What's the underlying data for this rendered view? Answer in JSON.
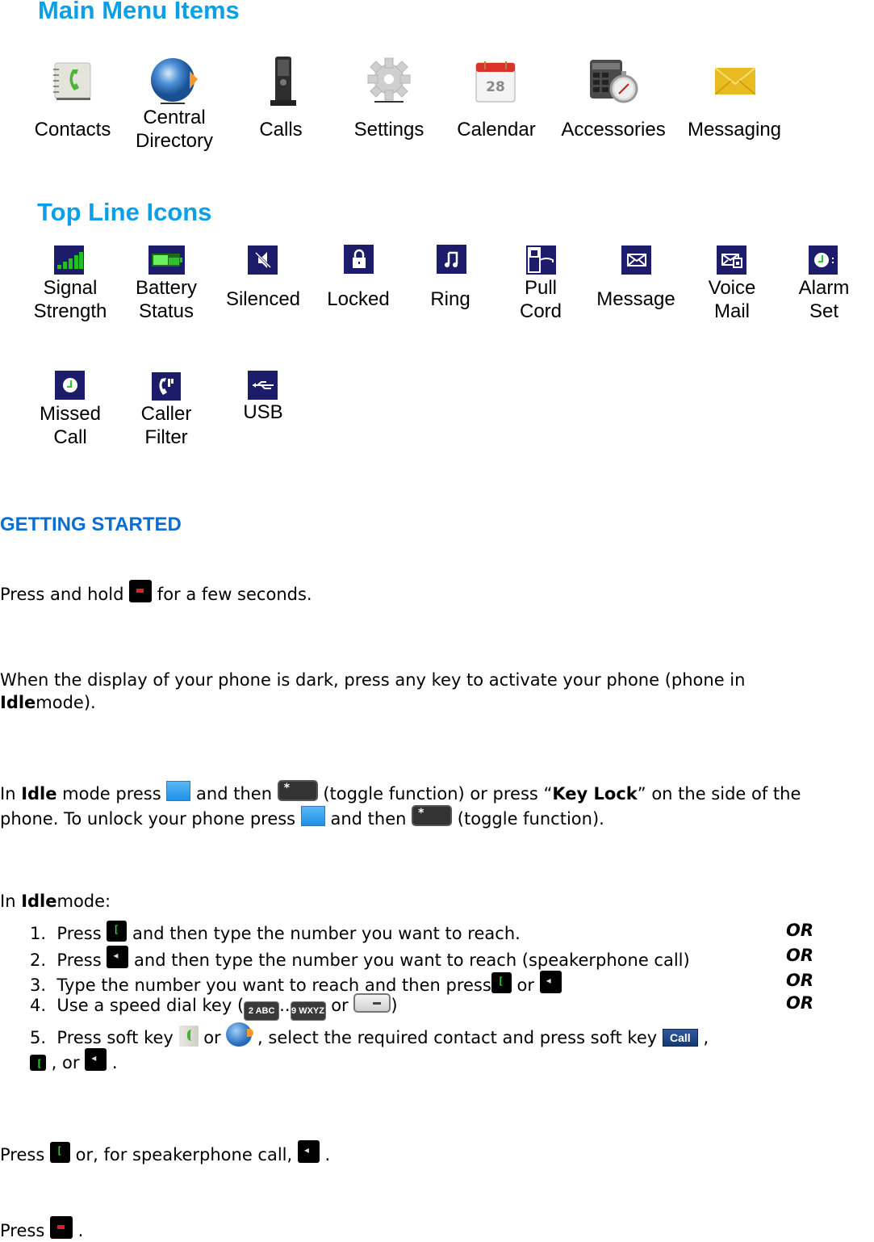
{
  "main_menu": {
    "title": "Main Menu Items",
    "items": [
      {
        "icon": "contacts-icon",
        "label_line1": "Contacts",
        "label_line2": ""
      },
      {
        "icon": "central-directory-globe-icon",
        "label_line1": "Central",
        "label_line2": "Directory"
      },
      {
        "icon": "calls-phone-icon",
        "label_line1": "Calls",
        "label_line2": ""
      },
      {
        "icon": "settings-gear-icon",
        "label_line1": "Settings",
        "label_line2": ""
      },
      {
        "icon": "calendar-icon",
        "label_line1": "Calendar",
        "label_line2": "",
        "calendar_day": "28"
      },
      {
        "icon": "accessories-calculator-icon",
        "label_line1": "Accessories",
        "label_line2": ""
      },
      {
        "icon": "messaging-envelope-icon",
        "label_line1": "Messaging",
        "label_line2": ""
      }
    ]
  },
  "top_line": {
    "title": "Top Line Icons",
    "items": [
      {
        "icon": "signal-strength-icon",
        "label_line1": "Signal",
        "label_line2": "Strength"
      },
      {
        "icon": "battery-status-icon",
        "label_line1": "Battery",
        "label_line2": "Status"
      },
      {
        "icon": "silenced-icon",
        "label_line1": "Silenced",
        "label_line2": ""
      },
      {
        "icon": "locked-icon",
        "label_line1": "Locked",
        "label_line2": ""
      },
      {
        "icon": "ring-icon",
        "label_line1": "Ring",
        "label_line2": ""
      },
      {
        "icon": "pull-cord-icon",
        "label_line1": "Pull",
        "label_line2": "Cord"
      },
      {
        "icon": "message-icon",
        "label_line1": "Message",
        "label_line2": ""
      },
      {
        "icon": "voice-mail-icon",
        "label_line1": "Voice",
        "label_line2": "Mail"
      },
      {
        "icon": "alarm-set-icon",
        "label_line1": "Alarm",
        "label_line2": "Set"
      },
      {
        "icon": "missed-call-icon",
        "label_line1": "Missed",
        "label_line2": "Call"
      },
      {
        "icon": "caller-filter-icon",
        "label_line1": "Caller",
        "label_line2": "Filter"
      },
      {
        "icon": "usb-icon",
        "label_line1": "USB",
        "label_line2": ""
      }
    ]
  },
  "getting_started": {
    "title": "GETTING STARTED",
    "p1": {
      "a": "Press and hold ",
      "b": " for a few seconds."
    },
    "p2": {
      "line1": "When the display of your phone is dark, press any key to activate your phone (phone in",
      "bold": "Idle",
      "rest": "mode)."
    },
    "p3": {
      "a": "In ",
      "bold1": "Idle",
      "b": " mode press ",
      "c": " and then ",
      "d": " (toggle function) or press “",
      "bold2": "Key Lock",
      "e": "” on the side of the",
      "line2a": "phone. To unlock your phone press ",
      "line2b": " and then ",
      "line2c": " (toggle function)."
    },
    "p4": {
      "a": "In ",
      "bold": "Idle",
      "b": "mode:"
    },
    "steps": [
      {
        "num": "1.",
        "a": "Press ",
        "b": " and then type the number you want to reach."
      },
      {
        "num": "2.",
        "a": "Press ",
        "b": " and then type the number you want to reach (speakerphone call)"
      },
      {
        "num": "3.",
        "a": "Type the number you want to reach and then press",
        "b": " or "
      },
      {
        "num": "4.",
        "a": "Use a speed dial key (",
        "b": "..",
        "c": " or ",
        "d": ")"
      },
      {
        "num": "5.",
        "a": "Press soft key ",
        "b": " or ",
        "c": " , select the required contact and press soft key ",
        "d": " ,",
        "line2a": " , or ",
        "line2b": " ."
      }
    ],
    "or_label": "OR",
    "keys": {
      "speed_first": "2 ABC",
      "speed_last": "9 WXYZ",
      "call_softkey": "Call",
      "star": "*"
    },
    "p5": {
      "a": "Press ",
      "b": " or, for speakerphone call, ",
      "c": " ."
    },
    "p6": {
      "a": "Press ",
      "b": " ."
    }
  }
}
